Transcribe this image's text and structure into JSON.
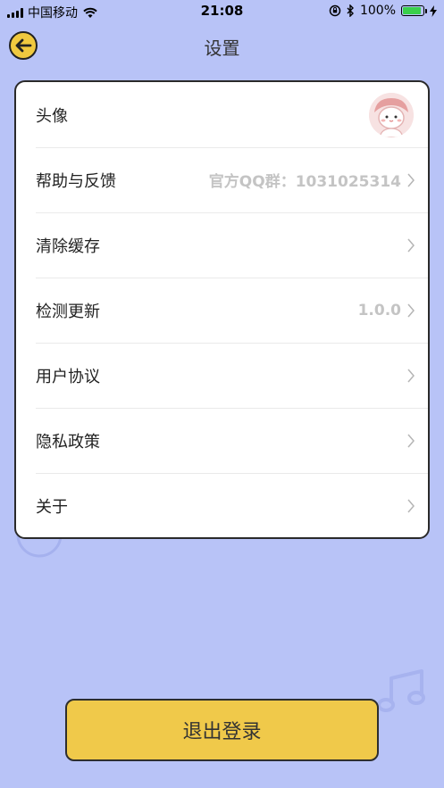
{
  "status_bar": {
    "carrier": "中国移动",
    "time": "21:08",
    "battery": "100%"
  },
  "header": {
    "title": "设置"
  },
  "settings": {
    "items": [
      {
        "label": "头像",
        "value": ""
      },
      {
        "label": "帮助与反馈",
        "value": "官方QQ群：1031025314"
      },
      {
        "label": "清除缓存",
        "value": ""
      },
      {
        "label": "检测更新",
        "value": "1.0.0"
      },
      {
        "label": "用户协议",
        "value": ""
      },
      {
        "label": "隐私政策",
        "value": ""
      },
      {
        "label": "关于",
        "value": ""
      }
    ]
  },
  "logout": {
    "label": "退出登录"
  },
  "colors": {
    "background": "#b8c3f7",
    "accent": "#f0c94a",
    "battery_fill": "#3ad04b"
  }
}
